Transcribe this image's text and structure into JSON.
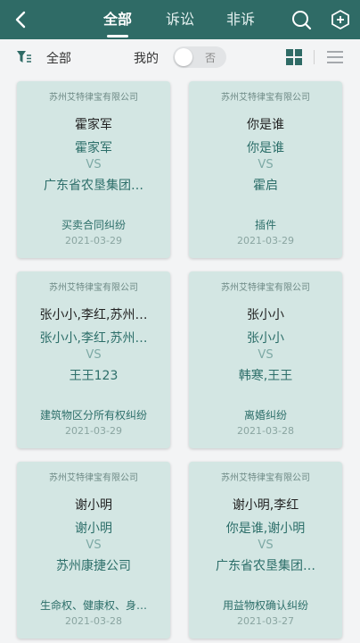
{
  "header": {
    "tabs": [
      {
        "label": "全部",
        "active": true
      },
      {
        "label": "诉讼",
        "active": false
      },
      {
        "label": "非诉",
        "active": false
      }
    ],
    "icons": {
      "back": "back-arrow-icon",
      "search": "search-icon",
      "add": "add-hexagon-icon"
    },
    "bar_color": "#2f6b66"
  },
  "filter": {
    "label": "全部",
    "mine_label": "我的",
    "toggle_text": "否",
    "view_icons": {
      "grid": "grid-view-icon",
      "list": "list-view-icon"
    }
  },
  "cards": [
    {
      "company": "苏州艾特律宝有限公司",
      "title": "霍家军",
      "plaintiff": "霍家军",
      "vs": "VS",
      "defendant": "广东省农垦集团…",
      "case_type": "买卖合同纠纷",
      "date": "2021-03-29"
    },
    {
      "company": "苏州艾特律宝有限公司",
      "title": "你是谁",
      "plaintiff": "你是谁",
      "vs": "VS",
      "defendant": "霍启",
      "case_type": "插件",
      "date": "2021-03-29"
    },
    {
      "company": "苏州艾特律宝有限公司",
      "title": "张小小,李红,苏州…",
      "plaintiff": "张小小,李红,苏州…",
      "vs": "VS",
      "defendant": "王王123",
      "case_type": "建筑物区分所有权纠纷",
      "date": "2021-03-29"
    },
    {
      "company": "苏州艾特律宝有限公司",
      "title": "张小小",
      "plaintiff": "张小小",
      "vs": "VS",
      "defendant": "韩寒,王王",
      "case_type": "离婚纠纷",
      "date": "2021-03-28"
    },
    {
      "company": "苏州艾特律宝有限公司",
      "title": "谢小明",
      "plaintiff": "谢小明",
      "vs": "VS",
      "defendant": "苏州康捷公司",
      "case_type": "生命权、健康权、身…",
      "date": "2021-03-28"
    },
    {
      "company": "苏州艾特律宝有限公司",
      "title": "谢小明,李红",
      "plaintiff": "你是谁,谢小明",
      "vs": "VS",
      "defendant": "广东省农垦集团…",
      "case_type": "用益物权确认纠纷",
      "date": "2021-03-27"
    }
  ]
}
